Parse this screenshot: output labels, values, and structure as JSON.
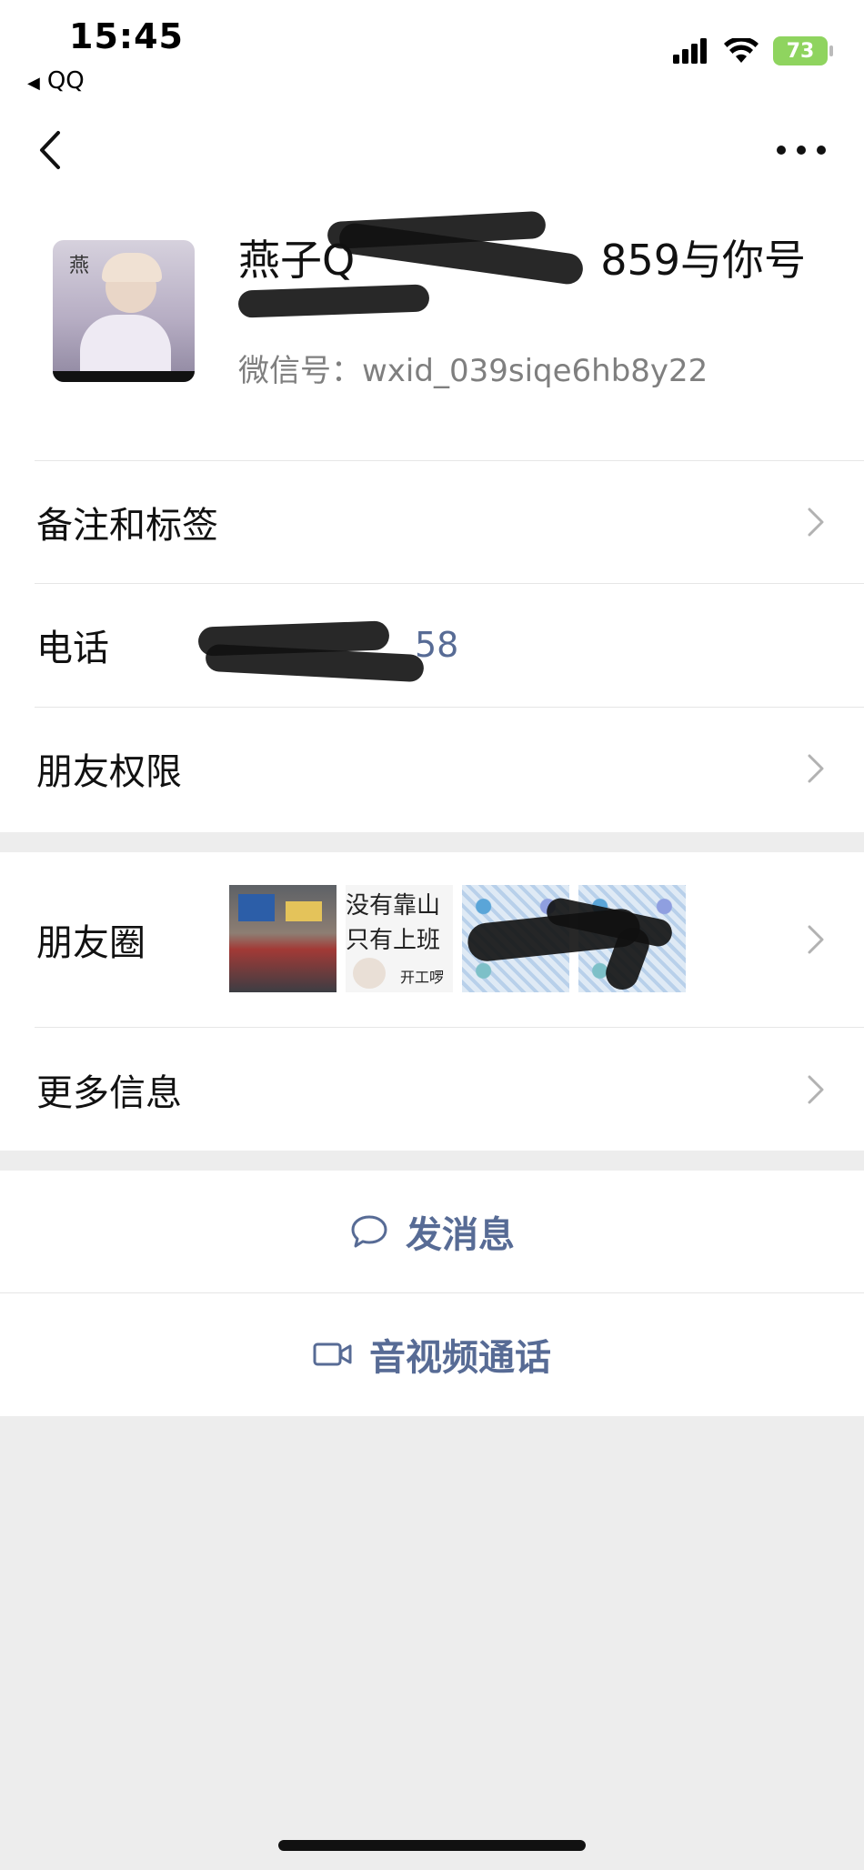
{
  "status_bar": {
    "time": "15:45",
    "back_app": "QQ",
    "battery": "73"
  },
  "profile": {
    "nickname_visible_start": "燕子Q",
    "nickname_visible_end": "859与你号",
    "wechat_id_label": "微信号：",
    "wechat_id": "wxid_039siqe6hb8y22"
  },
  "rows": {
    "remark_tags": "备注和标签",
    "phone_label": "电话",
    "phone_visible_suffix": "58",
    "friend_permissions": "朋友权限",
    "moments": "朋友圈",
    "more_info": "更多信息"
  },
  "moments_thumbs": {
    "thumb2_line1": "没有靠山",
    "thumb2_line2": "只有上班",
    "thumb2_caption": "开工啰"
  },
  "actions": {
    "send_message": "发消息",
    "video_call": "音视频通话"
  },
  "colors": {
    "link_blue": "#576b95",
    "page_bg": "#ededed",
    "battery_green": "#8fd45f"
  }
}
